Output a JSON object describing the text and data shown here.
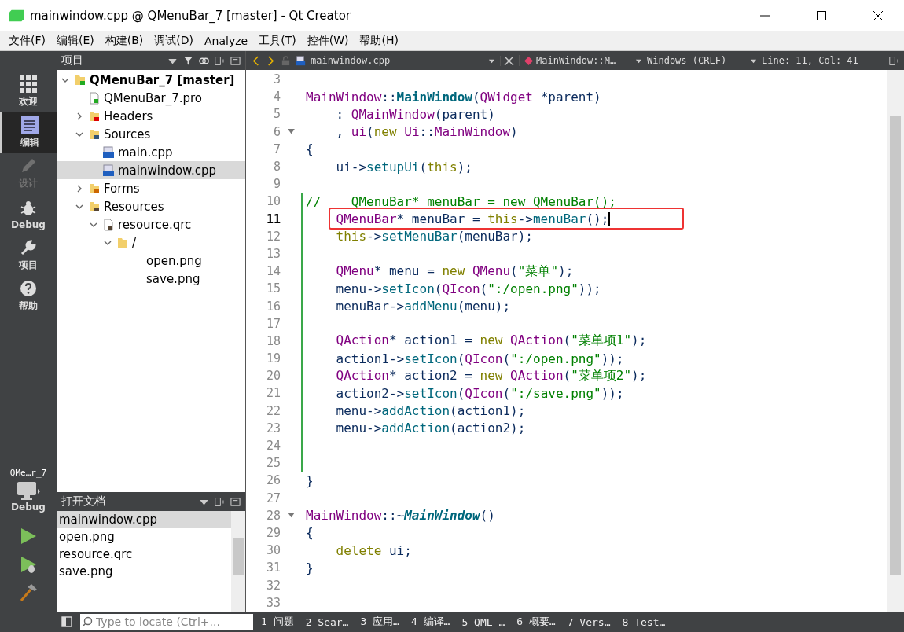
{
  "window": {
    "title": "mainwindow.cpp @ QMenuBar_7 [master] - Qt Creator"
  },
  "menu_bar": [
    "文件(F)",
    "编辑(E)",
    "构建(B)",
    "调试(D)",
    "Analyze",
    "工具(T)",
    "控件(W)",
    "帮助(H)"
  ],
  "mode_bar": {
    "modes": [
      {
        "label": "欢迎",
        "kind": "grid",
        "selected": false,
        "disabled": false
      },
      {
        "label": "编辑",
        "kind": "edit",
        "selected": true,
        "disabled": false
      },
      {
        "label": "设计",
        "kind": "pen",
        "selected": false,
        "disabled": true
      },
      {
        "label": "Debug",
        "kind": "bug",
        "selected": false,
        "disabled": false
      },
      {
        "label": "项目",
        "kind": "wrench",
        "selected": false,
        "disabled": false
      },
      {
        "label": "帮助",
        "kind": "help",
        "selected": false,
        "disabled": false
      }
    ],
    "kit": {
      "project": "QMe…r_7",
      "config": "Debug"
    }
  },
  "project_panel": {
    "title": "项目",
    "tree": [
      {
        "label": "QMenuBar_7 [master]",
        "kind": "project",
        "expanded": true,
        "selected": false,
        "children": [
          {
            "label": "QMenuBar_7.pro",
            "kind": "pro",
            "selected": false
          },
          {
            "label": "Headers",
            "kind": "headers",
            "expanded": false,
            "selected": false
          },
          {
            "label": "Sources",
            "kind": "sources",
            "expanded": true,
            "selected": false,
            "children": [
              {
                "label": "main.cpp",
                "kind": "cpp",
                "selected": false
              },
              {
                "label": "mainwindow.cpp",
                "kind": "cpp",
                "selected": true
              }
            ]
          },
          {
            "label": "Forms",
            "kind": "forms",
            "expanded": false,
            "selected": false
          },
          {
            "label": "Resources",
            "kind": "resources",
            "expanded": true,
            "selected": false,
            "children": [
              {
                "label": "resource.qrc",
                "kind": "qrc",
                "expanded": true,
                "selected": false,
                "children": [
                  {
                    "label": "/",
                    "kind": "folder",
                    "expanded": true,
                    "selected": false,
                    "children": [
                      {
                        "label": "open.png",
                        "selected": false
                      },
                      {
                        "label": "save.png",
                        "selected": false
                      }
                    ]
                  }
                ]
              }
            ]
          }
        ]
      }
    ]
  },
  "open_documents": {
    "title": "打开文档",
    "items": [
      {
        "label": "mainwindow.cpp",
        "selected": true
      },
      {
        "label": "open.png",
        "selected": false
      },
      {
        "label": "resource.qrc",
        "selected": false
      },
      {
        "label": "save.png",
        "selected": false
      }
    ]
  },
  "editor_toolbar": {
    "file": "mainwindow.cpp",
    "symbol": "MainWindow::M…",
    "line_endings": "Windows (CRLF)",
    "position": "Line: 11, Col: 41"
  },
  "editor": {
    "lines": [
      {
        "number": "3"
      },
      {
        "number": "4",
        "tokens": [
          {
            "kind": "type",
            "text": "MainWindow"
          },
          {
            "kind": "plain",
            "text": "::"
          },
          {
            "kind": "ctor",
            "text": "MainWindow"
          },
          {
            "kind": "plain",
            "text": "("
          },
          {
            "kind": "type",
            "text": "QWidget"
          },
          {
            "kind": "plain",
            "text": " *parent)"
          }
        ]
      },
      {
        "number": "5",
        "tokens": [
          {
            "kind": "plain",
            "text": "    : "
          },
          {
            "kind": "type",
            "text": "QMainWindow"
          },
          {
            "kind": "plain",
            "text": "(parent)"
          }
        ]
      },
      {
        "number": "6",
        "fold": true,
        "tokens": [
          {
            "kind": "plain",
            "text": "    , "
          },
          {
            "kind": "type",
            "text": "ui"
          },
          {
            "kind": "plain",
            "text": "("
          },
          {
            "kind": "keyword",
            "text": "new"
          },
          {
            "kind": "type",
            "text": " Ui"
          },
          {
            "kind": "plain",
            "text": "::"
          },
          {
            "kind": "type",
            "text": "MainWindow"
          },
          {
            "kind": "plain",
            "text": ")"
          }
        ]
      },
      {
        "number": "7",
        "tokens": [
          {
            "kind": "plain",
            "text": "{"
          }
        ]
      },
      {
        "number": "8",
        "tokens": [
          {
            "kind": "plain",
            "text": "    ui->"
          },
          {
            "kind": "func",
            "text": "setupUi"
          },
          {
            "kind": "plain",
            "text": "("
          },
          {
            "kind": "keyword",
            "text": "this"
          },
          {
            "kind": "plain",
            "text": ");"
          }
        ]
      },
      {
        "number": "9"
      },
      {
        "number": "10",
        "changed": true,
        "tokens": [
          {
            "kind": "comment",
            "text": "//    QMenuBar* menuBar = new QMenuBar();"
          }
        ]
      },
      {
        "number": "11",
        "changed": true,
        "current": true,
        "boxed": true,
        "tokens": [
          {
            "kind": "type",
            "text": "    QMenuBar"
          },
          {
            "kind": "plain",
            "text": "* menuBar = "
          },
          {
            "kind": "keyword",
            "text": "this"
          },
          {
            "kind": "plain",
            "text": "->"
          },
          {
            "kind": "func",
            "text": "menuBar"
          },
          {
            "kind": "plain",
            "text": "();"
          }
        ]
      },
      {
        "number": "12",
        "changed": true,
        "tokens": [
          {
            "kind": "keyword",
            "text": "    this"
          },
          {
            "kind": "plain",
            "text": "->"
          },
          {
            "kind": "func",
            "text": "setMenuBar"
          },
          {
            "kind": "plain",
            "text": "(menuBar);"
          }
        ]
      },
      {
        "number": "13",
        "changed": true
      },
      {
        "number": "14",
        "changed": true,
        "tokens": [
          {
            "kind": "type",
            "text": "    QMenu"
          },
          {
            "kind": "plain",
            "text": "* menu = "
          },
          {
            "kind": "keyword",
            "text": "new"
          },
          {
            "kind": "type",
            "text": " QMenu"
          },
          {
            "kind": "plain",
            "text": "("
          },
          {
            "kind": "string",
            "text": "\"菜单\""
          },
          {
            "kind": "plain",
            "text": ");"
          }
        ]
      },
      {
        "number": "15",
        "changed": true,
        "tokens": [
          {
            "kind": "plain",
            "text": "    menu->"
          },
          {
            "kind": "func",
            "text": "setIcon"
          },
          {
            "kind": "plain",
            "text": "("
          },
          {
            "kind": "type",
            "text": "QIcon"
          },
          {
            "kind": "plain",
            "text": "("
          },
          {
            "kind": "string",
            "text": "\":/open.png\""
          },
          {
            "kind": "plain",
            "text": "));"
          }
        ]
      },
      {
        "number": "16",
        "changed": true,
        "tokens": [
          {
            "kind": "plain",
            "text": "    menuBar->"
          },
          {
            "kind": "func",
            "text": "addMenu"
          },
          {
            "kind": "plain",
            "text": "(menu);"
          }
        ]
      },
      {
        "number": "17",
        "changed": true
      },
      {
        "number": "18",
        "changed": true,
        "tokens": [
          {
            "kind": "type",
            "text": "    QAction"
          },
          {
            "kind": "plain",
            "text": "* action1 = "
          },
          {
            "kind": "keyword",
            "text": "new"
          },
          {
            "kind": "type",
            "text": " QAction"
          },
          {
            "kind": "plain",
            "text": "("
          },
          {
            "kind": "string",
            "text": "\"菜单项1\""
          },
          {
            "kind": "plain",
            "text": ");"
          }
        ]
      },
      {
        "number": "19",
        "changed": true,
        "tokens": [
          {
            "kind": "plain",
            "text": "    action1->"
          },
          {
            "kind": "func",
            "text": "setIcon"
          },
          {
            "kind": "plain",
            "text": "("
          },
          {
            "kind": "type",
            "text": "QIcon"
          },
          {
            "kind": "plain",
            "text": "("
          },
          {
            "kind": "string",
            "text": "\":/open.png\""
          },
          {
            "kind": "plain",
            "text": "));"
          }
        ]
      },
      {
        "number": "20",
        "changed": true,
        "tokens": [
          {
            "kind": "type",
            "text": "    QAction"
          },
          {
            "kind": "plain",
            "text": "* action2 = "
          },
          {
            "kind": "keyword",
            "text": "new"
          },
          {
            "kind": "type",
            "text": " QAction"
          },
          {
            "kind": "plain",
            "text": "("
          },
          {
            "kind": "string",
            "text": "\"菜单项2\""
          },
          {
            "kind": "plain",
            "text": ");"
          }
        ]
      },
      {
        "number": "21",
        "changed": true,
        "tokens": [
          {
            "kind": "plain",
            "text": "    action2->"
          },
          {
            "kind": "func",
            "text": "setIcon"
          },
          {
            "kind": "plain",
            "text": "("
          },
          {
            "kind": "type",
            "text": "QIcon"
          },
          {
            "kind": "plain",
            "text": "("
          },
          {
            "kind": "string",
            "text": "\":/save.png\""
          },
          {
            "kind": "plain",
            "text": "));"
          }
        ]
      },
      {
        "number": "22",
        "changed": true,
        "tokens": [
          {
            "kind": "plain",
            "text": "    menu->"
          },
          {
            "kind": "func",
            "text": "addAction"
          },
          {
            "kind": "plain",
            "text": "(action1);"
          }
        ]
      },
      {
        "number": "23",
        "changed": true,
        "tokens": [
          {
            "kind": "plain",
            "text": "    menu->"
          },
          {
            "kind": "func",
            "text": "addAction"
          },
          {
            "kind": "plain",
            "text": "(action2);"
          }
        ]
      },
      {
        "number": "24",
        "changed": true
      },
      {
        "number": "25",
        "changed": true
      },
      {
        "number": "26",
        "tokens": [
          {
            "kind": "plain",
            "text": "}"
          }
        ]
      },
      {
        "number": "27"
      },
      {
        "number": "28",
        "fold": true,
        "tokens": [
          {
            "kind": "type",
            "text": "MainWindow"
          },
          {
            "kind": "plain",
            "text": "::~"
          },
          {
            "kind": "dtor",
            "text": "MainWindow"
          },
          {
            "kind": "plain",
            "text": "()"
          }
        ]
      },
      {
        "number": "29",
        "tokens": [
          {
            "kind": "plain",
            "text": "{"
          }
        ]
      },
      {
        "number": "30",
        "tokens": [
          {
            "kind": "keyword",
            "text": "    delete"
          },
          {
            "kind": "plain",
            "text": " ui;"
          }
        ]
      },
      {
        "number": "31",
        "tokens": [
          {
            "kind": "plain",
            "text": "}"
          }
        ]
      },
      {
        "number": "32"
      },
      {
        "number": "33"
      }
    ]
  },
  "status_bar": {
    "locate_placeholder": "Type to locate (Ctrl+...",
    "panes": [
      "1 问题",
      "2 Sear…",
      "3 应用…",
      "4 编译…",
      "5 QML …",
      "6 概要…",
      "7 Vers…",
      "8 Test…"
    ]
  }
}
